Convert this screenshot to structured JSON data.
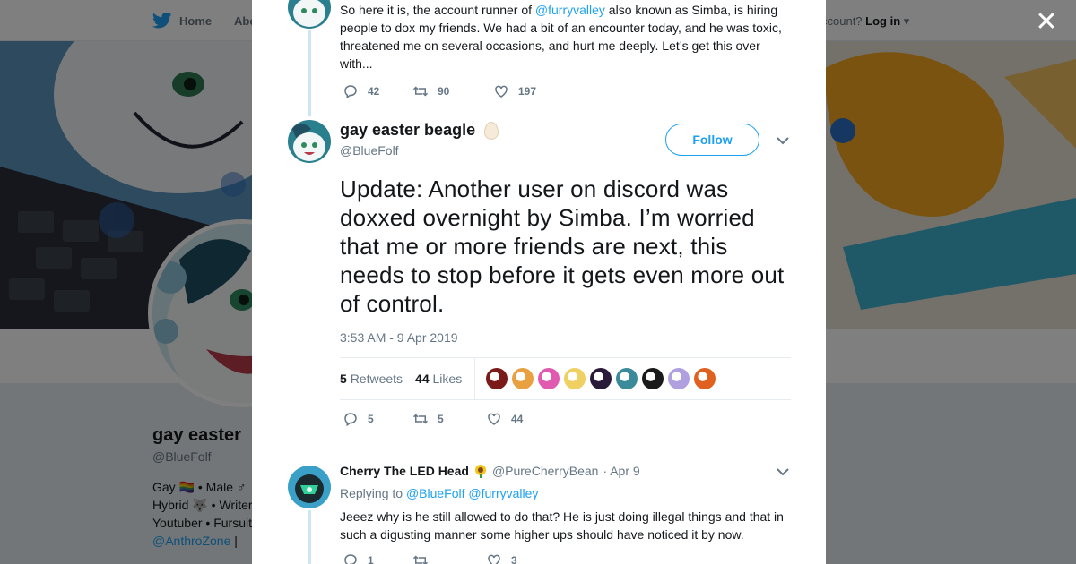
{
  "nav": {
    "home_label": "Home",
    "about_label": "Abo",
    "login_prefix": "ccount?",
    "login_label": "Log in"
  },
  "profile": {
    "name": "gay easter",
    "handle": "@BlueFolf",
    "bio_line1": "Gay 🏳️‍🌈 • Male ♂",
    "bio_line2": "Hybrid 🐺 • Writer",
    "bio_line3": "Youtuber • Fursuit",
    "bio_link": "@AnthroZone",
    "bio_link_suffix": " |"
  },
  "modal": {
    "close_label": "✕",
    "previous_tweet": {
      "text_before": "So here it is, the account runner of ",
      "mention": "@furryvalley",
      "text_after": " also known as Simba, is hiring people to dox my friends. We had a bit of an encounter today, and he was toxic, threatened me on several occasions, and hurt me deeply. Let’s get this over with...",
      "replies": "42",
      "retweets": "90",
      "likes": "197"
    },
    "main_tweet": {
      "author_name": "gay easter beagle",
      "author_handle": "@BlueFolf",
      "follow_label": "Follow",
      "text": "Update: Another user on discord was doxxed overnight by Simba. I’m worried that me or more friends are next, this needs to stop before it gets even more out of control.",
      "timestamp": "3:53 AM - 9 Apr 2019",
      "retweet_count": "5",
      "retweet_label": "Retweets",
      "like_count": "44",
      "like_label": "Likes",
      "action_replies": "5",
      "action_retweets": "5",
      "action_likes": "44",
      "liker_avatar_colors": [
        "#7a1a1a",
        "#e8a040",
        "#e05ab0",
        "#f0d060",
        "#2a1a3a",
        "#3a8a9a",
        "#1a1a1a",
        "#b0a0e0",
        "#e06020"
      ]
    },
    "reply_tweet": {
      "author_name": "Cherry The LED Head",
      "author_handle": "@PureCherryBean",
      "date": "· Apr 9",
      "replying_prefix": "Replying to",
      "replying_to_1": "@BlueFolf",
      "replying_to_2": "@furryvalley",
      "text": "Jeeez why is he still allowed to do that? He is just doing illegal things and that in such a digusting manner some higher ups should have noticed it by now.",
      "replies": "1",
      "likes": "3"
    }
  },
  "colors": {
    "accent": "#1da1f2",
    "overlay": "rgba(0,0,0,0.5)",
    "muted_text": "#657786"
  }
}
